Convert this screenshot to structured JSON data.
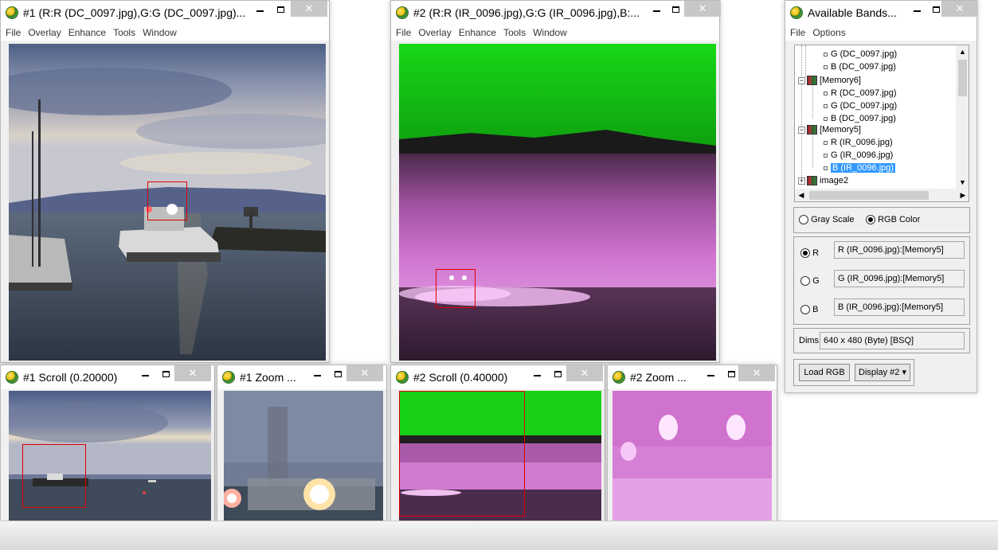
{
  "colors": {
    "title_bg": "#ffffff",
    "close_btn": "#c7c7c7",
    "roi_box": "#e00000",
    "selection": "#3399ff",
    "ir_green": "#21e021",
    "ir_magenta": "#cc66cc"
  },
  "windows": {
    "img1": {
      "title": "#1 (R:R (DC_0097.jpg),G:G (DC_0097.jpg)...",
      "menu": [
        "File",
        "Overlay",
        "Enhance",
        "Tools",
        "Window"
      ]
    },
    "img2": {
      "title": "#2 (R:R (IR_0096.jpg),G:G (IR_0096.jpg),B:...",
      "menu": [
        "File",
        "Overlay",
        "Enhance",
        "Tools",
        "Window"
      ]
    },
    "scroll1": {
      "title": "#1 Scroll (0.20000)"
    },
    "zoom1": {
      "title": "#1 Zoom ..."
    },
    "scroll2": {
      "title": "#2 Scroll (0.40000)"
    },
    "zoom2": {
      "title": "#2 Zoom ..."
    },
    "bands": {
      "title": "Available Bands...",
      "menu": [
        "File",
        "Options"
      ],
      "tree": [
        {
          "label": "G (DC_0097.jpg)",
          "kind": "band"
        },
        {
          "label": "B (DC_0097.jpg)",
          "kind": "band"
        },
        {
          "label": "[Memory6]",
          "kind": "group"
        },
        {
          "label": "R (DC_0097.jpg)",
          "kind": "band"
        },
        {
          "label": "G (DC_0097.jpg)",
          "kind": "band"
        },
        {
          "label": "B (DC_0097.jpg)",
          "kind": "band"
        },
        {
          "label": "[Memory5]",
          "kind": "group"
        },
        {
          "label": "R (IR_0096.jpg)",
          "kind": "band"
        },
        {
          "label": "G (IR_0096.jpg)",
          "kind": "band"
        },
        {
          "label": "B (IR_0096.jpg)",
          "kind": "band",
          "selected": true
        },
        {
          "label": "image2",
          "kind": "group"
        }
      ],
      "mode": {
        "gray_label": "Gray Scale",
        "rgb_label": "RGB Color",
        "selected": "RGB Color"
      },
      "channels": [
        {
          "label": "R",
          "value": "R (IR_0096.jpg):[Memory5]",
          "selected": true
        },
        {
          "label": "G",
          "value": "G (IR_0096.jpg):[Memory5]",
          "selected": false
        },
        {
          "label": "B",
          "value": "B (IR_0096.jpg):[Memory5]",
          "selected": false
        }
      ],
      "dims_label": "Dims",
      "dims_value": "640 x 480 (Byte) [BSQ]",
      "load_button": "Load RGB",
      "display_button": "Display #2 ▾"
    }
  }
}
